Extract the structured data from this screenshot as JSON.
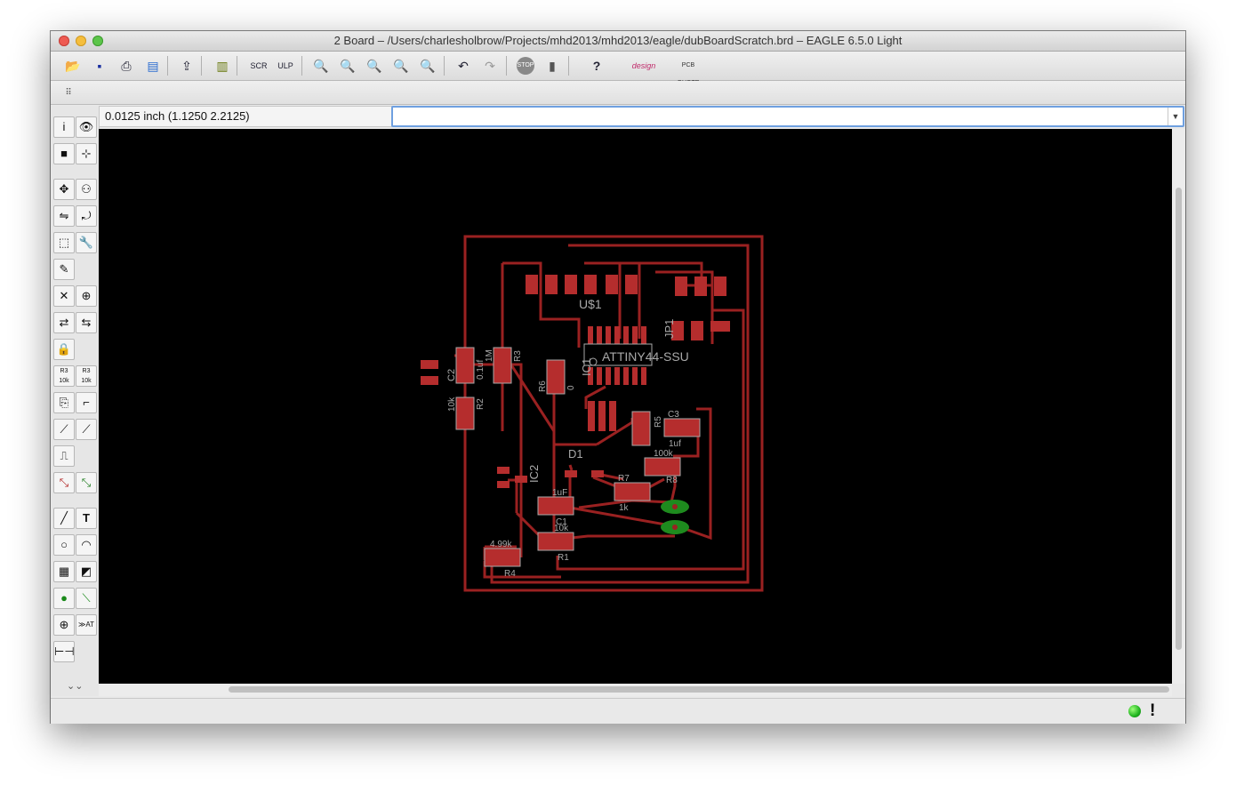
{
  "window": {
    "title": "2 Board – /Users/charlesholbrow/Projects/mhd2013/mhd2013/eagle/dubBoardScratch.brd – EAGLE 6.5.0 Light"
  },
  "toolbar": {
    "icons": [
      "open-icon",
      "save-icon",
      "print-icon",
      "cam-icon",
      "use-icon",
      "library-icon",
      "script-icon",
      "ulp-icon",
      "zoom-fit-icon",
      "zoom-in-icon",
      "zoom-out-icon",
      "zoom-redraw-icon",
      "zoom-select-icon",
      "undo-icon",
      "redo-icon",
      "stop-icon",
      "go-icon",
      "help-icon",
      "design-link-logo",
      "pcb-quote-logo"
    ]
  },
  "coords": {
    "readout": "0.0125 inch (1.1250 2.2125)"
  },
  "command": {
    "value": ""
  },
  "board": {
    "labels": {
      "u1": "U$1",
      "jp1": "JP1",
      "ic1": "IC1",
      "attiny": "ATTINY44-SSU",
      "c2": "C2",
      "c2_val": "0.1uf",
      "r3": "R3",
      "r3_val": "1M",
      "r6": "R6",
      "r6_val": "0",
      "r2": "R2",
      "r2_val": "10k",
      "r5": "R5",
      "c3": "C3",
      "c3_val": "1uf",
      "d1": "D1",
      "ic2": "IC2",
      "r7": "R7",
      "r7_val": "1k",
      "r8": "R8",
      "r8_val": "100k",
      "c1": "C1",
      "c1_val": "1uF",
      "r1": "R1",
      "r1_val": "10k",
      "r4": "R4",
      "r4_val": "4.99k"
    },
    "colors": {
      "trace": "#9a2121",
      "pad": "#b52d2d",
      "via": "#1e8a1e",
      "silk": "#a9a9a9",
      "background": "#000000"
    }
  },
  "status": {
    "indicator": "green-led",
    "alert": "!"
  }
}
